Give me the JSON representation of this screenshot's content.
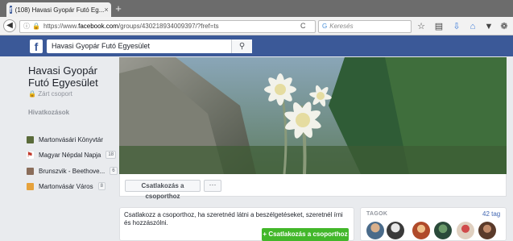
{
  "browser": {
    "tab_title": "(108) Havasi Gyopár Futó Eg...",
    "tab_close": "×",
    "new_tab": "+",
    "url_prefix": "https://www.",
    "url_domain": "facebook.com",
    "url_path": "/groups/430218934009397/?fref=ts",
    "search_placeholder": "Keresés",
    "search_engine_glyph": "G"
  },
  "fb": {
    "logo": "f",
    "search_value": "Havasi Gyopár Futó Egyesület",
    "brand_color": "#3b5998"
  },
  "group": {
    "name": "Havasi Gyopár Futó Egyesület",
    "status": "Zárt csoport",
    "links_heading": "Hivatkozások",
    "links": [
      {
        "label": "Martonvásári Könyvtár",
        "icon": "library-icon",
        "color": "#5a6b3a",
        "badge": ""
      },
      {
        "label": "Magyar Népdal Napja",
        "icon": "flag-icon",
        "color": "#c0392b",
        "badge": "18"
      },
      {
        "label": "Brunszvik - Beethove...",
        "icon": "palace-icon",
        "color": "#8a6d5a",
        "badge": "6"
      },
      {
        "label": "Martonvásár Város",
        "icon": "town-icon",
        "color": "#e6a23c",
        "badge": "8"
      }
    ]
  },
  "cover": {
    "join_button": "Csatlakozás a csoporthoz",
    "more_button": "···"
  },
  "join_card": {
    "text": "Csatlakozz a csoporthoz, ha szeretnéd látni a beszélgetéseket, szeretnél írni és hozzászólni.",
    "button": "+ Csatlakozás a csoporthoz"
  },
  "members": {
    "label": "TAGOK",
    "count": "42 tag"
  }
}
